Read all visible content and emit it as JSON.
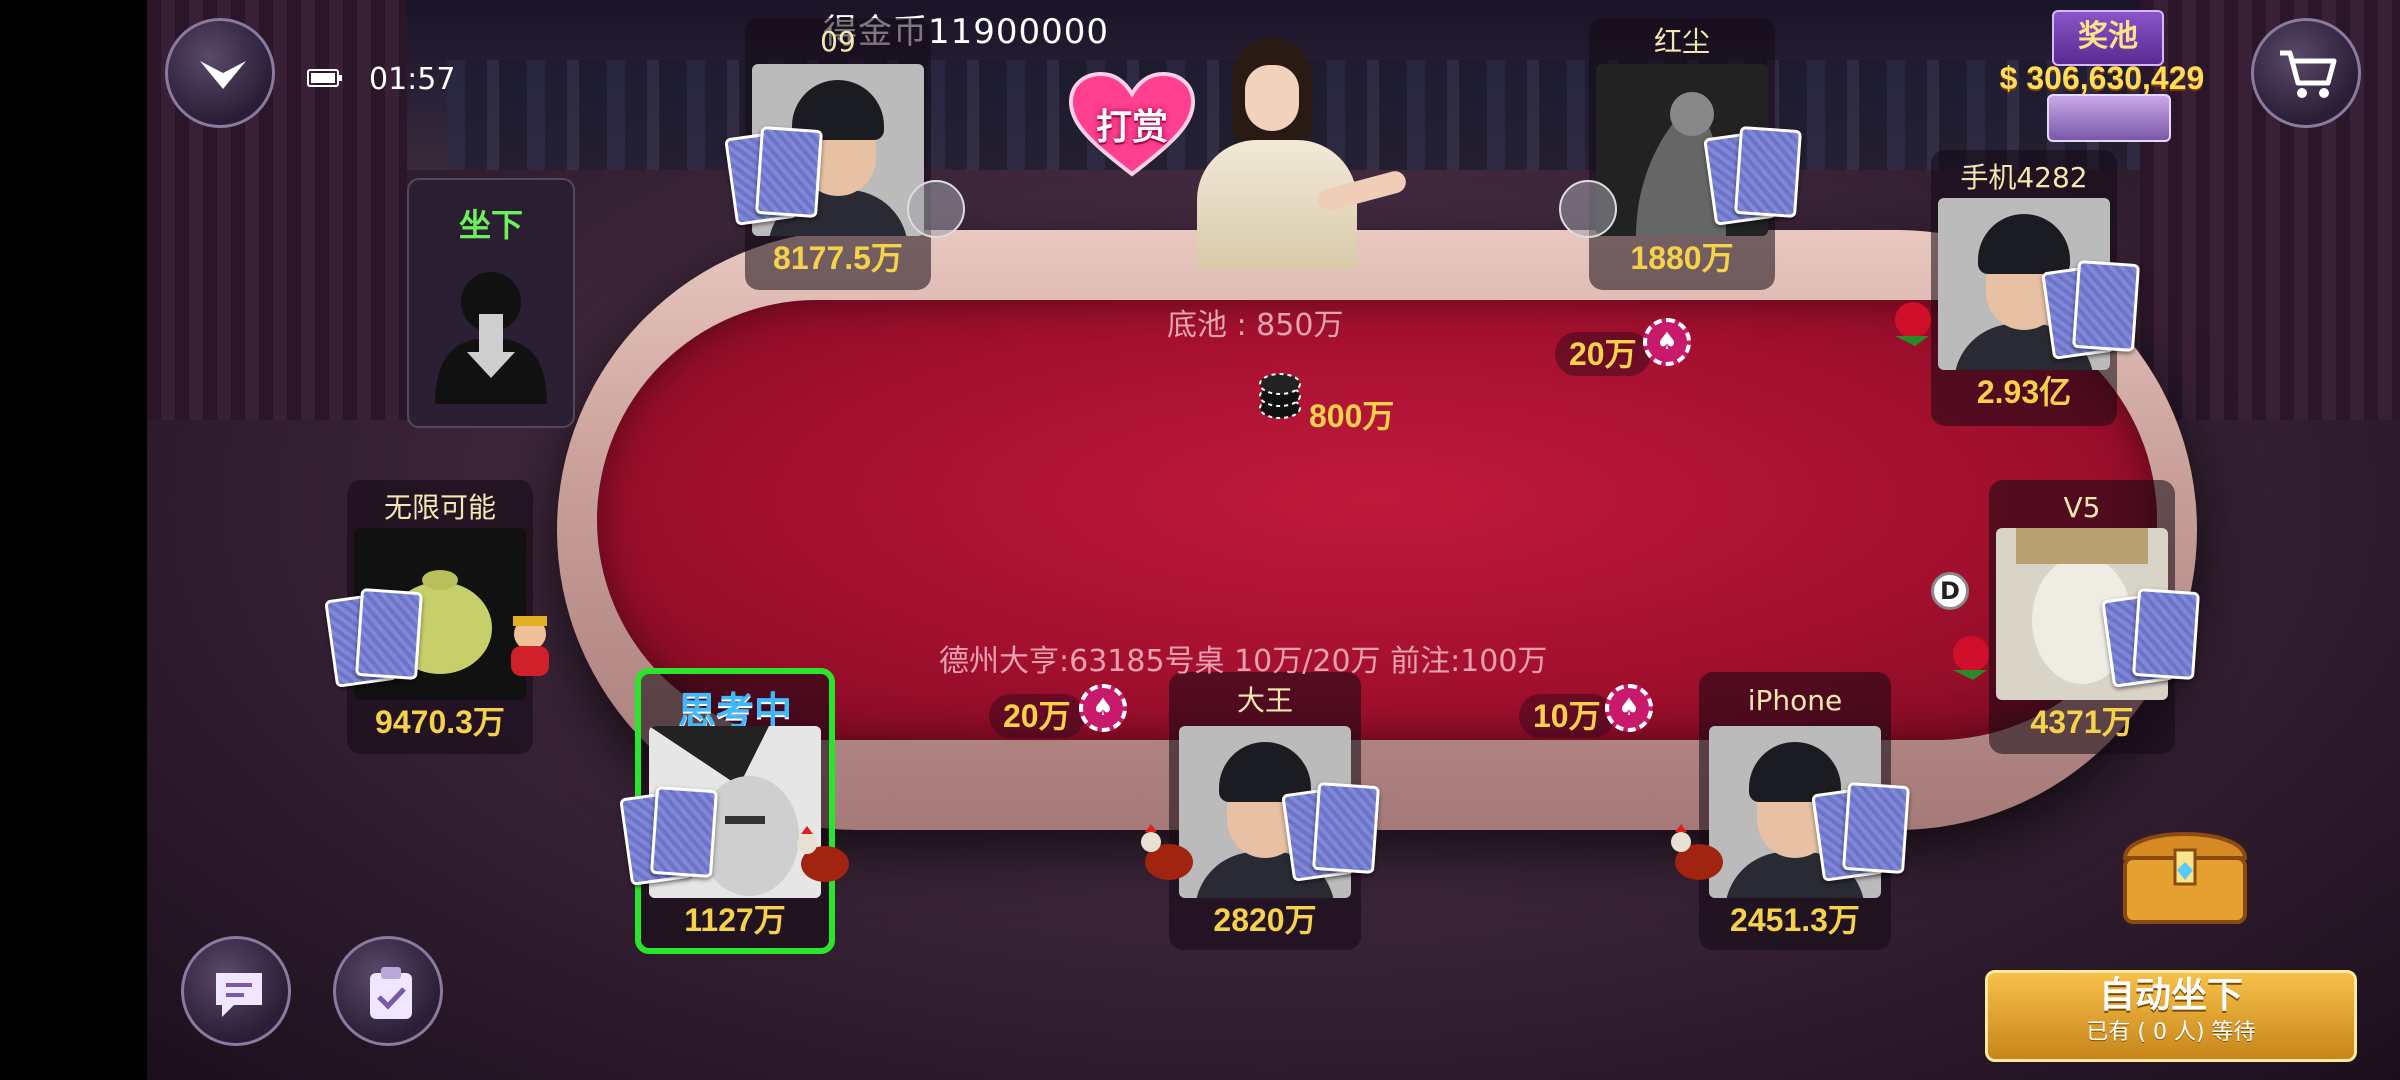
{
  "status": {
    "time": "01:57"
  },
  "notice": {
    "text": "得金币11900000"
  },
  "jackpot": {
    "label": "奖池",
    "amount": "$ 306,630,429"
  },
  "tip": {
    "label": "打赏"
  },
  "sitdown": {
    "label": "坐下"
  },
  "pot": {
    "label": "底池 : 850万",
    "center_bet": "800万"
  },
  "table_info": {
    "text": "德州大亨:63185号桌  10万/20万  前注:100万"
  },
  "seats": [
    {
      "name": "09",
      "chips": "8177.5万"
    },
    {
      "name": "红尘",
      "chips": "1880万"
    },
    {
      "name": "手机4282",
      "chips": "2.93亿"
    },
    {
      "name": "无限可能",
      "chips": "9470.3万"
    },
    {
      "name": "V5",
      "chips": "4371万"
    },
    {
      "name": "思考中",
      "chips": "1127万"
    },
    {
      "name": "大王",
      "chips": "2820万"
    },
    {
      "name": "iPhone",
      "chips": "2451.3万"
    }
  ],
  "bets": {
    "seat_red_dust": "20万",
    "seat_thinking": "20万",
    "seat_dawang": "10万"
  },
  "dealer_button": "D",
  "auto_sit": {
    "title": "自动坐下",
    "subtitle": "已有 ( 0 人) 等待"
  },
  "icons": {
    "menu": "chevron-down-icon",
    "cart": "cart-icon",
    "chat": "chat-icon",
    "tasks": "clipboard-check-icon",
    "battery": "battery-icon"
  },
  "colors": {
    "felt": "#b5143a",
    "chip_gold": "#f6d14a",
    "active_border": "#29e62c",
    "sit_green": "#6df05a"
  }
}
